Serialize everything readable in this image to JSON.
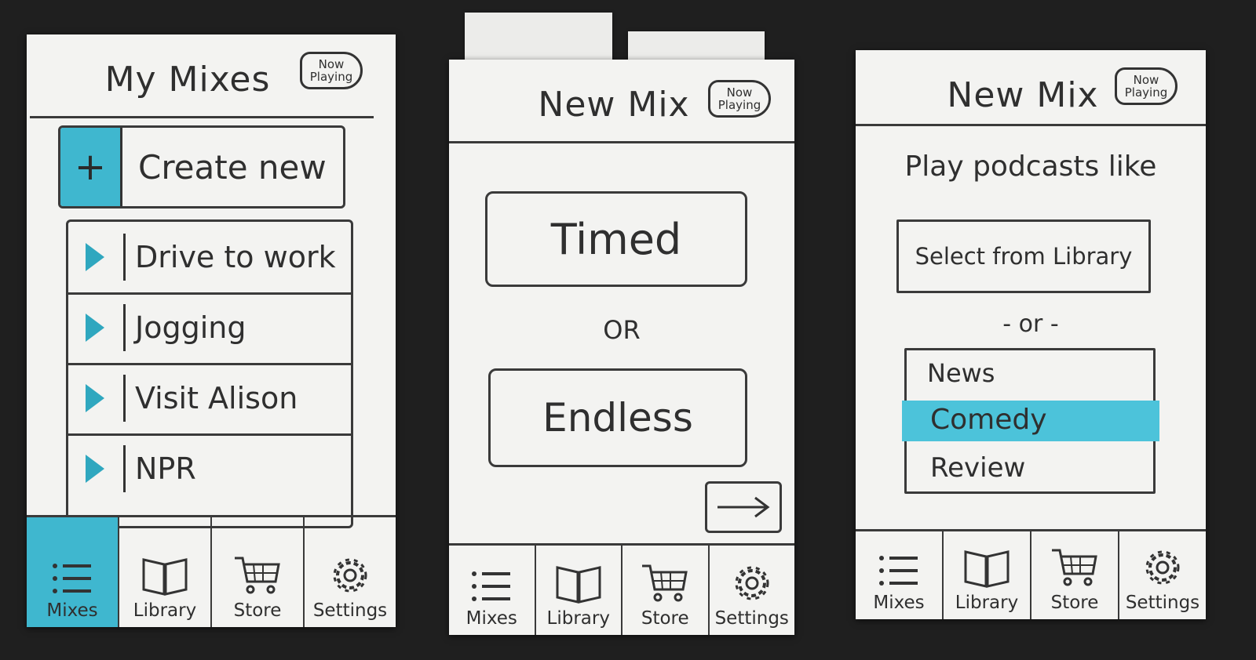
{
  "screens": [
    {
      "title": "My Mixes",
      "now_playing": "Now Playing",
      "create_new": {
        "icon": "+",
        "label": "Create new"
      },
      "mixes": [
        {
          "label": "Drive to work"
        },
        {
          "label": "Jogging"
        },
        {
          "label": "Visit Alison"
        },
        {
          "label": "NPR"
        }
      ],
      "tabs": [
        {
          "label": "Mixes",
          "icon": "list-icon",
          "active": true
        },
        {
          "label": "Library",
          "icon": "book-icon"
        },
        {
          "label": "Store",
          "icon": "cart-icon"
        },
        {
          "label": "Settings",
          "icon": "gear-icon"
        }
      ]
    },
    {
      "title": "New Mix",
      "now_playing": "Now Playing",
      "timed_label": "Timed",
      "or_label": "OR",
      "endless_label": "Endless",
      "next_icon": "arrow-right-icon",
      "tabs": [
        {
          "label": "Mixes",
          "icon": "list-icon"
        },
        {
          "label": "Library",
          "icon": "book-icon"
        },
        {
          "label": "Store",
          "icon": "cart-icon"
        },
        {
          "label": "Settings",
          "icon": "gear-icon"
        }
      ]
    },
    {
      "title": "New Mix",
      "now_playing": "Now Playing",
      "prompt": "Play podcasts like",
      "select_button": "Select from Library",
      "or_label": "- or -",
      "genres": [
        {
          "label": "News",
          "selected": false
        },
        {
          "label": "Comedy",
          "selected": true
        },
        {
          "label": "Review",
          "selected": false
        }
      ],
      "tabs": [
        {
          "label": "Mixes",
          "icon": "list-icon"
        },
        {
          "label": "Library",
          "icon": "book-icon"
        },
        {
          "label": "Store",
          "icon": "cart-icon"
        },
        {
          "label": "Settings",
          "icon": "gear-icon"
        }
      ]
    }
  ],
  "colors": {
    "accent": "#3fb7cf",
    "paper": "#f3f3f1",
    "background": "#1f1f1f",
    "ink": "#2f2f2f"
  }
}
